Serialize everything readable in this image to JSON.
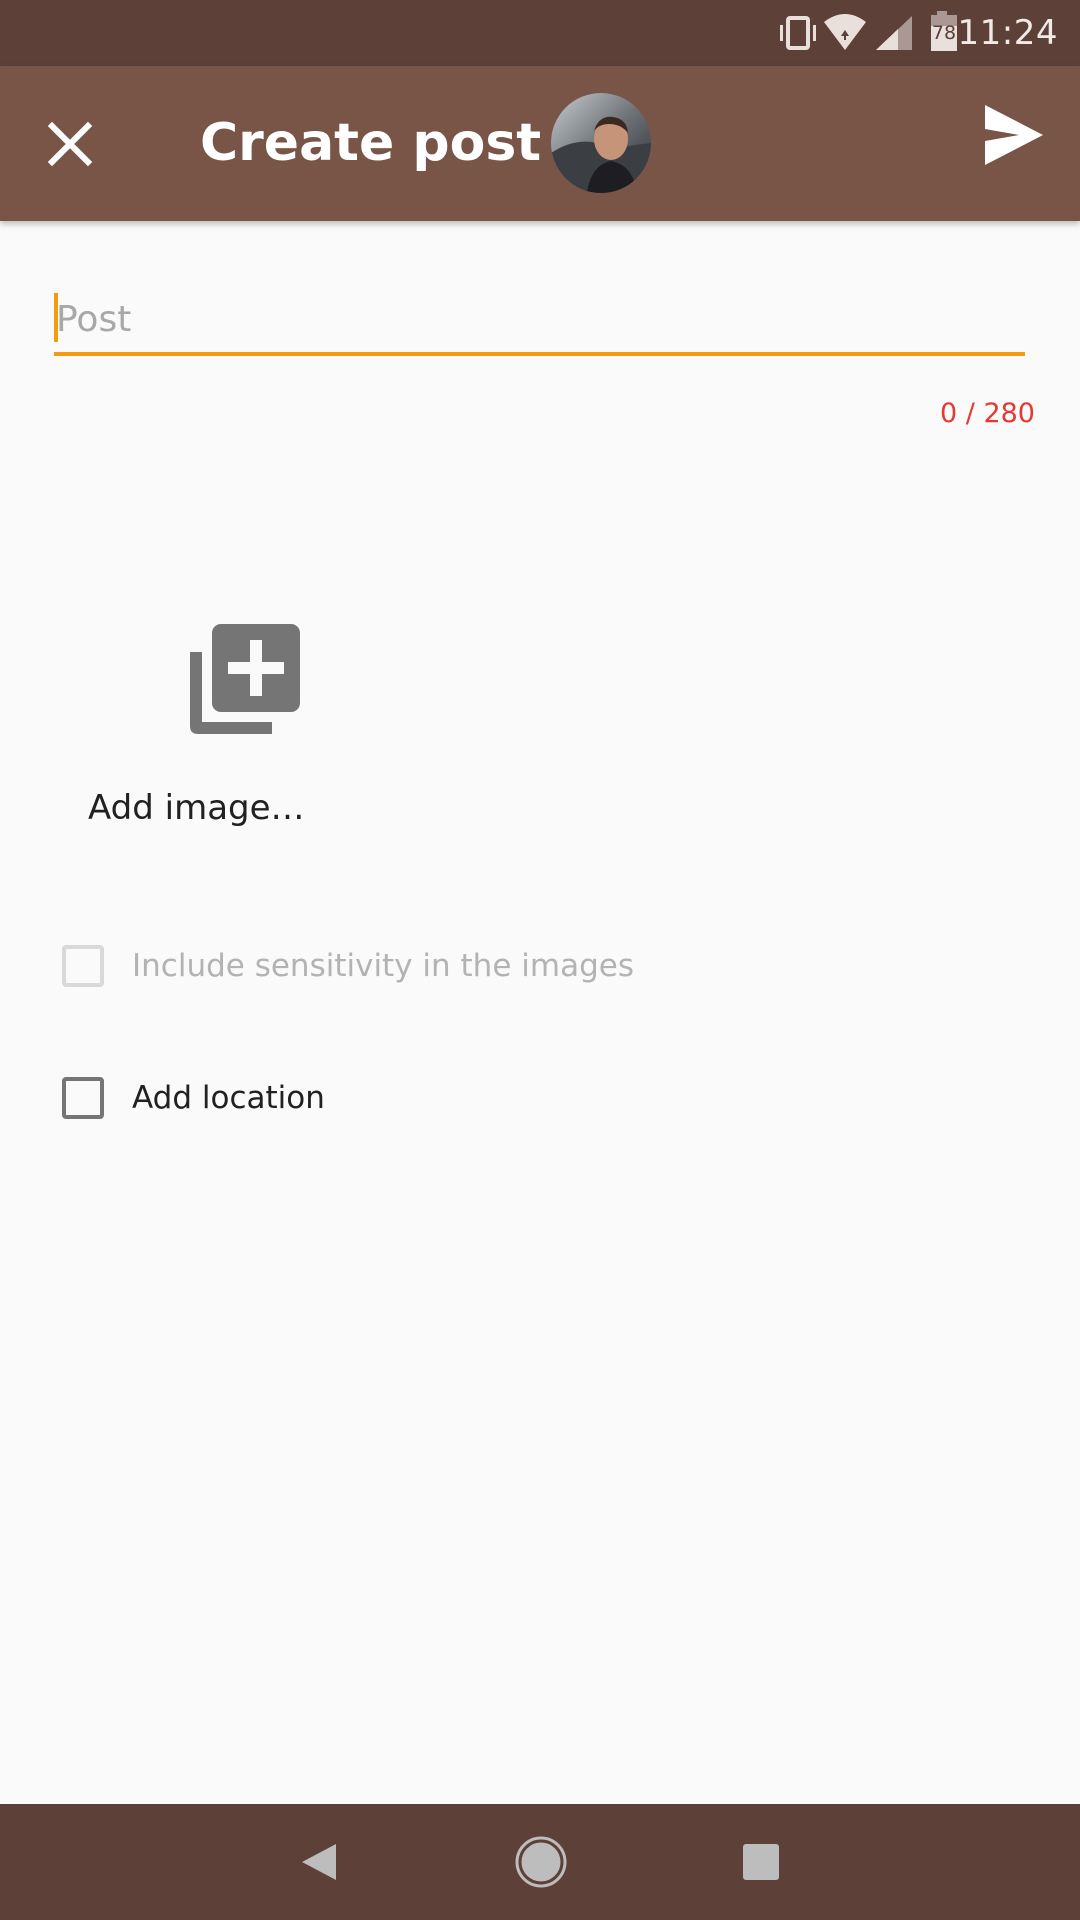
{
  "status_bar": {
    "time": "11:24",
    "battery_level": "78",
    "icons": [
      "vibrate-icon",
      "wifi-icon",
      "signal-icon",
      "battery-icon"
    ]
  },
  "app_bar": {
    "title": "Create post",
    "close_icon": "close-icon",
    "send_icon": "send-icon",
    "background_color": "#795548"
  },
  "post": {
    "placeholder": "Post",
    "value": "",
    "counter": "0 / 280",
    "accent_color": "#f39c12",
    "counter_color": "#e53935"
  },
  "add_image": {
    "label": "Add image…",
    "icon": "add-photo-library-icon"
  },
  "options": {
    "sensitivity_label": "Include sensitivity in the images",
    "sensitivity_checked": false,
    "sensitivity_enabled": false,
    "location_label": "Add location",
    "location_checked": false
  },
  "nav_bar": {
    "buttons": [
      "back-icon",
      "home-icon",
      "recents-icon"
    ],
    "background_color": "#5d4037"
  }
}
